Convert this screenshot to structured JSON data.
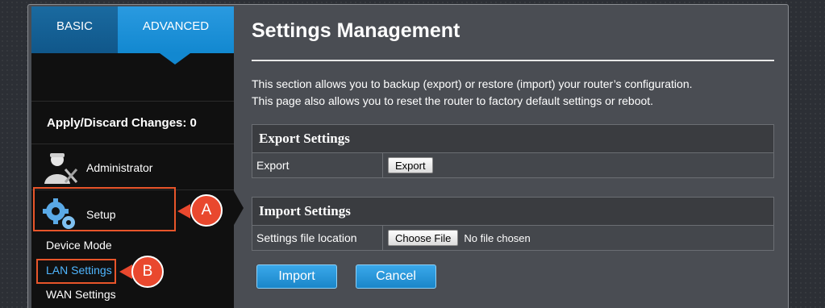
{
  "sidebar": {
    "tabs": [
      {
        "label": "BASIC"
      },
      {
        "label": "ADVANCED"
      }
    ],
    "apply_label": "Apply/Discard Changes: 0",
    "items": [
      {
        "label": "Administrator",
        "icon": "administrator-icon"
      },
      {
        "label": "Setup",
        "icon": "gears-icon"
      }
    ],
    "sub_items": [
      {
        "label": "Device Mode"
      },
      {
        "label": "LAN Settings"
      },
      {
        "label": "WAN Settings"
      }
    ]
  },
  "callouts": {
    "a": "A",
    "b": "B"
  },
  "main": {
    "title": "Settings Management",
    "description_lines": [
      "This section allows you to backup (export) or restore (import) your router’s configuration.",
      "This page also allows you to reset the router to factory default settings or reboot."
    ],
    "export_section": {
      "heading": "Export Settings",
      "row_label": "Export",
      "button_label": "Export"
    },
    "import_section": {
      "heading": "Import Settings",
      "row_label": "Settings file location",
      "choose_label": "Choose File",
      "file_status": "No file chosen"
    },
    "import_button": "Import",
    "cancel_button": "Cancel"
  },
  "colors": {
    "accent_blue": "#1288d0",
    "highlight_orange": "#e8552a",
    "active_link": "#4fb6ff"
  }
}
